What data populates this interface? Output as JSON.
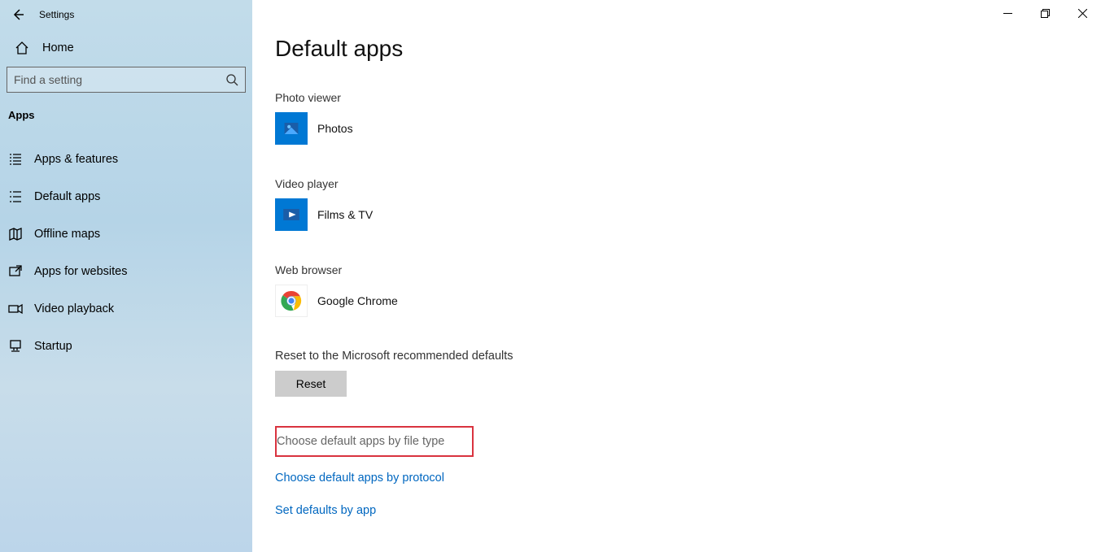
{
  "window": {
    "title": "Settings"
  },
  "sidebar": {
    "home": "Home",
    "search_placeholder": "Find a setting",
    "group": "Apps",
    "items": [
      {
        "label": "Apps & features"
      },
      {
        "label": "Default apps"
      },
      {
        "label": "Offline maps"
      },
      {
        "label": "Apps for websites"
      },
      {
        "label": "Video playback"
      },
      {
        "label": "Startup"
      }
    ]
  },
  "main": {
    "title": "Default apps",
    "sections": {
      "photo_viewer_label": "Photo viewer",
      "photo_viewer_app": "Photos",
      "video_player_label": "Video player",
      "video_player_app": "Films & TV",
      "web_browser_label": "Web browser",
      "web_browser_app": "Google Chrome",
      "reset_label": "Reset to the Microsoft recommended defaults",
      "reset_button": "Reset",
      "link_file_type": "Choose default apps by file type",
      "link_protocol": "Choose default apps by protocol",
      "link_by_app": "Set defaults by app"
    }
  }
}
